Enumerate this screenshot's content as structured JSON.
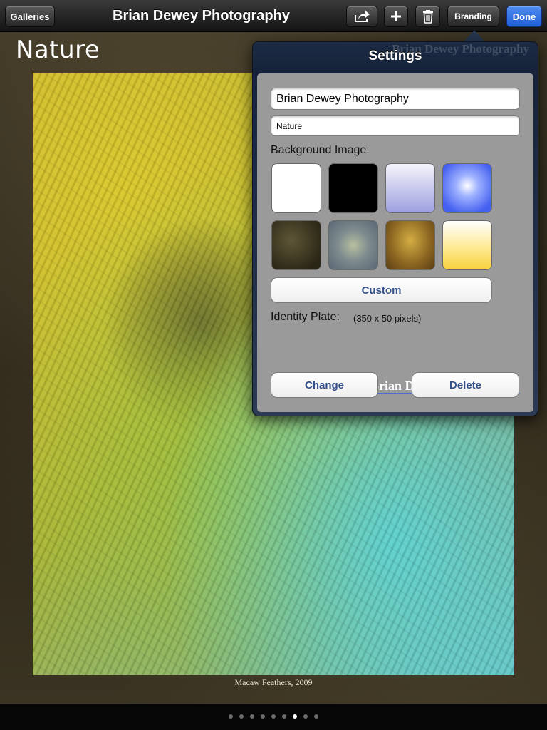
{
  "toolbar": {
    "galleries_label": "Galleries",
    "title": "Brian Dewey Photography",
    "branding_label": "Branding",
    "done_label": "Done"
  },
  "gallery": {
    "title": "Nature",
    "photo_caption": "Macaw Feathers, 2009"
  },
  "pagination": {
    "count": 9,
    "active_index": 6
  },
  "settings": {
    "title": "Settings",
    "site_title_value": "Brian Dewey Photography",
    "gallery_name_value": "Nature",
    "background_label": "Background Image:",
    "background_swatches": [
      {
        "name": "white",
        "color": "#ffffff"
      },
      {
        "name": "black",
        "color": "#000000"
      },
      {
        "name": "lavender-gradient",
        "color": "#aeb0e6"
      },
      {
        "name": "blue-radial",
        "color": "#5b7cf7"
      },
      {
        "name": "dark-texture",
        "color": "#3f3a24"
      },
      {
        "name": "blue-gray-texture",
        "color": "#8d9b9b"
      },
      {
        "name": "amber-texture",
        "color": "#a07b28"
      },
      {
        "name": "yellow-gradient",
        "color": "#fde277"
      }
    ],
    "custom_label": "Custom",
    "identity_plate_label": "Identity Plate:",
    "identity_plate_size": "(350 x 50 pixels)",
    "identity_plate_text": "Brian Dewey Photography",
    "change_label": "Change",
    "delete_label": "Delete"
  }
}
